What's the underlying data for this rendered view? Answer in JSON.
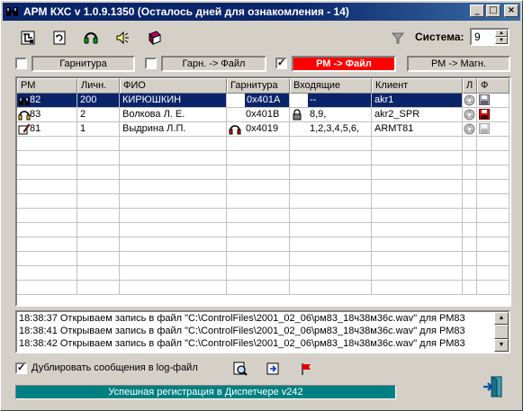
{
  "window": {
    "title": "АРМ КХС  v 1.0.9.1350 (Осталось дней для ознакомления - 14)",
    "minimize": "_",
    "maximize": "□",
    "close": "×"
  },
  "toolbar": {
    "icons": [
      "network-icon",
      "refresh-icon",
      "headset-icon",
      "speaker-icon",
      "book-icon"
    ]
  },
  "system": {
    "label": "Система:",
    "value": "9"
  },
  "modes": [
    {
      "label": "Гарнитура",
      "checked": false,
      "active": false
    },
    {
      "label": "Гарн. -> Файл",
      "checked": false,
      "active": false
    },
    {
      "label": "РМ -> Файл",
      "checked": true,
      "active": true
    },
    {
      "label": "РМ -> Магн.",
      "checked": null,
      "active": false
    }
  ],
  "grid": {
    "columns": [
      "РМ",
      "Личн.",
      "ФИО",
      "Гарнитура",
      "Входящие",
      "Клиент",
      "Л",
      "Ф"
    ],
    "rows": [
      {
        "rm": "82",
        "lichn": "200",
        "fio": "КИРЮШКИН",
        "garnitura": "0x401A",
        "vhod": "--",
        "client": "akr1",
        "selected": true
      },
      {
        "rm": "83",
        "lichn": "2",
        "fio": "Волкова Л. Е.",
        "garnitura": "0x401B",
        "vhod": "8,9,",
        "client": "akr2_SPR",
        "selected": false
      },
      {
        "rm": "81",
        "lichn": "1",
        "fio": "Выдрина Л.П.",
        "garnitura": "0x4019",
        "vhod": "1,2,3,4,5,6,",
        "client": "ARMT81",
        "selected": false
      }
    ]
  },
  "log": {
    "lines": [
      "18:38:37 Открываем запись в файл \"C:\\ControlFiles\\2001_02_06\\рм83_18ч38м36с.wav\" для РМ83",
      "18:38:41 Открываем запись в файл \"C:\\ControlFiles\\2001_02_06\\рм83_18ч38м36с.wav\" для РМ83",
      "18:38:42 Открываем запись в файл \"C:\\ControlFiles\\2001_02_06\\рм83_18ч38м36с.wav\" для РМ83"
    ]
  },
  "options": {
    "duplicate_label": "Дублировать сообщения в log-файл",
    "duplicate_checked": true
  },
  "status": {
    "text": "Успешная регистрация в Диспетчере v242"
  },
  "colors": {
    "title_bar": "#0a246a",
    "active_mode": "#ff0000",
    "status_bar": "#008080",
    "selection": "#0a246a"
  }
}
